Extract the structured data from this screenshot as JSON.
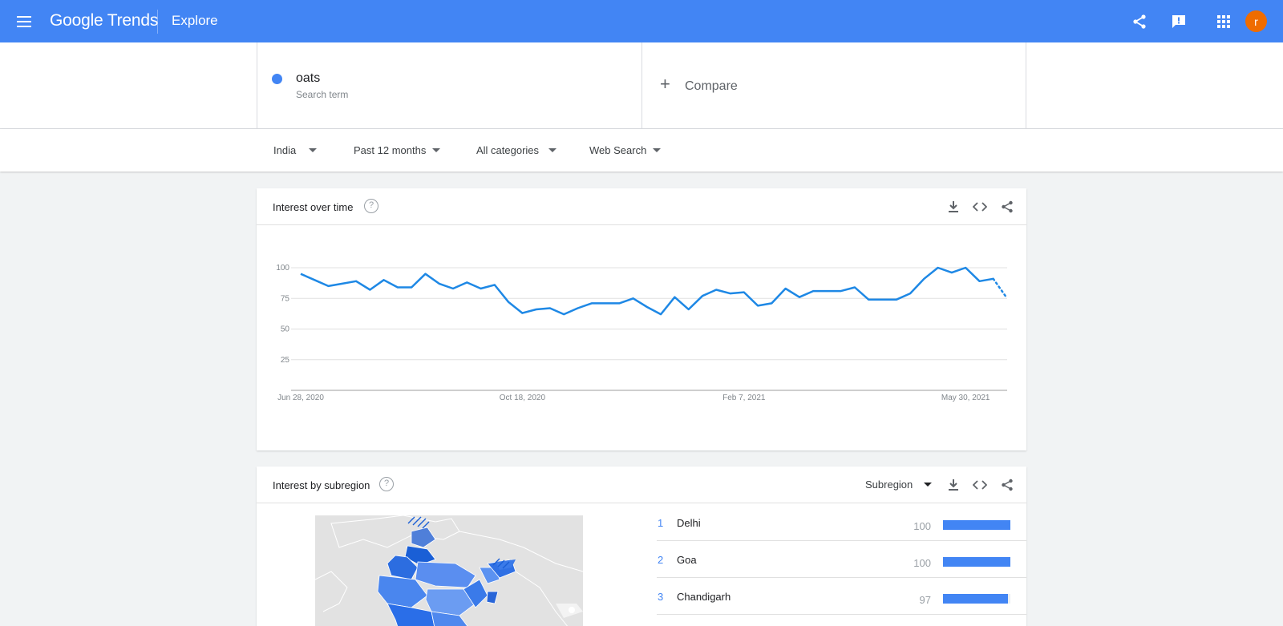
{
  "header": {
    "logo": "Google Trends",
    "page": "Explore",
    "avatar_letter": "r"
  },
  "search_terms": [
    {
      "term": "oats",
      "type": "Search term",
      "color": "#4285f4"
    }
  ],
  "compare_label": "Compare",
  "filters": {
    "region": "India",
    "time": "Past 12 months",
    "category": "All categories",
    "property": "Web Search"
  },
  "interest_over_time": {
    "title": "Interest over time",
    "help": "?"
  },
  "chart_data": {
    "type": "line",
    "title": "",
    "xlabel": "",
    "ylabel": "",
    "ylim": [
      0,
      100
    ],
    "y_ticks": [
      "25",
      "50",
      "75",
      "100"
    ],
    "x_tick_labels": [
      "Jun 28, 2020",
      "Oct 18, 2020",
      "Feb 7, 2021",
      "May 30, 2021"
    ],
    "x_tick_index": [
      0,
      16,
      32,
      48
    ],
    "partial_from_index": 50,
    "grid": true,
    "series": [
      {
        "name": "oats",
        "color": "#1e88e5",
        "values": [
          95,
          90,
          85,
          87,
          89,
          82,
          90,
          84,
          84,
          95,
          87,
          83,
          88,
          83,
          86,
          72,
          63,
          66,
          67,
          62,
          67,
          71,
          71,
          71,
          75,
          68,
          62,
          76,
          66,
          77,
          82,
          79,
          80,
          69,
          71,
          83,
          76,
          81,
          81,
          81,
          84,
          74,
          74,
          74,
          79,
          91,
          100,
          96,
          100,
          89,
          91,
          75
        ]
      }
    ]
  },
  "interest_by_subregion": {
    "title": "Interest by subregion",
    "help": "?",
    "resolution": "Subregion",
    "rows": [
      {
        "rank": "1",
        "name": "Delhi",
        "value": "100",
        "pct": 100
      },
      {
        "rank": "2",
        "name": "Goa",
        "value": "100",
        "pct": 100
      },
      {
        "rank": "3",
        "name": "Chandigarh",
        "value": "97",
        "pct": 97
      }
    ]
  },
  "icons": {
    "menu": "menu-icon",
    "share": "share-icon",
    "feedback": "feedback-icon",
    "apps": "apps-icon",
    "download": "download-icon",
    "embed": "embed-icon",
    "help": "help-icon",
    "add": "plus-icon"
  }
}
